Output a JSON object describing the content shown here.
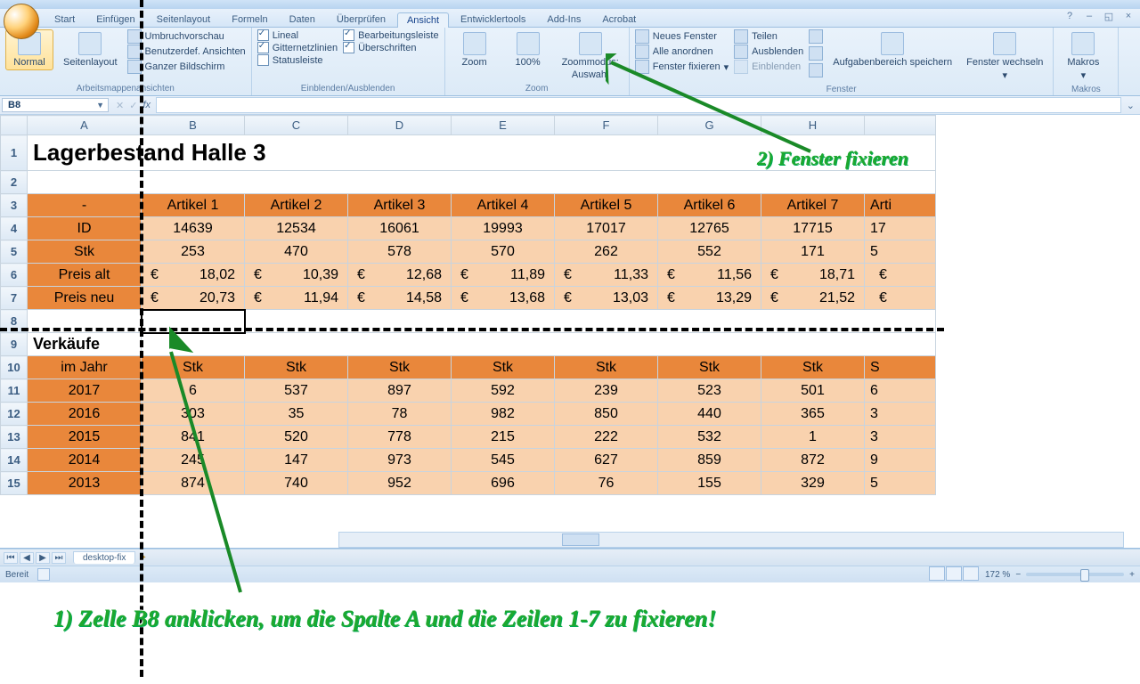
{
  "tabs": [
    "Start",
    "Einfügen",
    "Seitenlayout",
    "Formeln",
    "Daten",
    "Überprüfen",
    "Ansicht",
    "Entwicklertools",
    "Add-Ins",
    "Acrobat"
  ],
  "active_tab": "Ansicht",
  "ribbon": {
    "views": {
      "normal": "Normal",
      "layout": "Seitenlayout",
      "umbruch": "Umbruchvorschau",
      "benutzer": "Benutzerdef. Ansichten",
      "ganz": "Ganzer Bildschirm",
      "group": "Arbeitsmappenansichten"
    },
    "show": {
      "lineal": "Lineal",
      "gitter": "Gitternetzlinien",
      "status": "Statusleiste",
      "bearb": "Bearbeitungsleiste",
      "ueber": "Überschriften",
      "group": "Einblenden/Ausblenden"
    },
    "zoom": {
      "zoom": "Zoom",
      "p100": "100%",
      "auswahl1": "Zoommodus:",
      "auswahl2": "Auswahl",
      "group": "Zoom"
    },
    "fenster": {
      "neu": "Neues Fenster",
      "alle": "Alle anordnen",
      "fix": "Fenster fixieren",
      "teilen": "Teilen",
      "aus": "Ausblenden",
      "ein": "Einblenden",
      "save": "Aufgabenbereich speichern",
      "wechsel": "Fenster wechseln",
      "group": "Fenster"
    },
    "makros": {
      "label": "Makros",
      "group": "Makros"
    }
  },
  "namebox": "B8",
  "columns": [
    "A",
    "B",
    "C",
    "D",
    "E",
    "F",
    "G",
    "H"
  ],
  "title": "Lagerbestand Halle 3",
  "rows_top": {
    "dash": "-",
    "headers": [
      "Artikel 1",
      "Artikel 2",
      "Artikel 3",
      "Artikel 4",
      "Artikel 5",
      "Artikel 6",
      "Artikel 7",
      "Arti"
    ],
    "id_label": "ID",
    "id": [
      "14639",
      "12534",
      "16061",
      "19993",
      "17017",
      "12765",
      "17715",
      "17"
    ],
    "stk_label": "Stk",
    "stk": [
      "253",
      "470",
      "578",
      "570",
      "262",
      "552",
      "171",
      "5"
    ],
    "pa_label": "Preis alt",
    "pa": [
      "18,02",
      "10,39",
      "12,68",
      "11,89",
      "11,33",
      "11,56",
      "18,71",
      ""
    ],
    "pn_label": "Preis neu",
    "pn": [
      "20,73",
      "11,94",
      "14,58",
      "13,68",
      "13,03",
      "13,29",
      "21,52",
      ""
    ]
  },
  "verk": "Verkäufe",
  "rows_bot": {
    "jahr_label": "im Jahr",
    "jahr_hdr": [
      "Stk",
      "Stk",
      "Stk",
      "Stk",
      "Stk",
      "Stk",
      "Stk",
      "S"
    ],
    "y": [
      {
        "y": "2017",
        "v": [
          "6",
          "537",
          "897",
          "592",
          "239",
          "523",
          "501",
          "6"
        ]
      },
      {
        "y": "2016",
        "v": [
          "303",
          "35",
          "78",
          "982",
          "850",
          "440",
          "365",
          "3"
        ]
      },
      {
        "y": "2015",
        "v": [
          "841",
          "520",
          "778",
          "215",
          "222",
          "532",
          "1",
          "3"
        ]
      },
      {
        "y": "2014",
        "v": [
          "245",
          "147",
          "973",
          "545",
          "627",
          "859",
          "872",
          "9"
        ]
      },
      {
        "y": "2013",
        "v": [
          "874",
          "740",
          "952",
          "696",
          "76",
          "155",
          "329",
          "5"
        ]
      }
    ]
  },
  "euro": "€",
  "sheet_tab": "desktop-fix",
  "status": "Bereit",
  "zoom": "172 %",
  "ann1": "1) Zelle B8 anklicken, um die Spalte A und die Zeilen 1-7 zu fixieren!",
  "ann2": "2) Fenster fixieren"
}
